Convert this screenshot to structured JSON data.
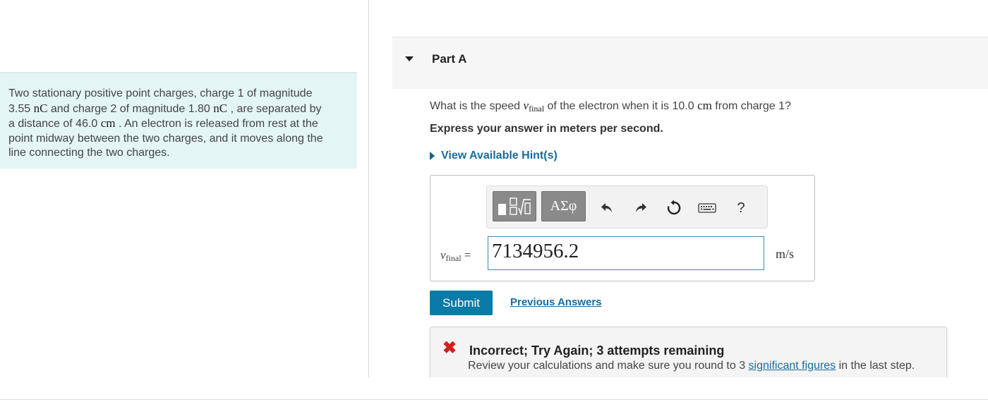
{
  "problem": {
    "t1": "Two stationary positive point charges, charge 1 of magnitude",
    "v1": "3.55",
    "u1": "nC",
    "t2": " and charge 2 of magnitude ",
    "v2": "1.80",
    "u2": "nC",
    "t3": " , are separated by",
    "t4": "a distance of ",
    "v3": "46.0",
    "u3": "cm",
    "t5": " . An electron is released from rest at the",
    "t6": "point midway between the two charges, and it moves along the",
    "t7": "line connecting the two charges."
  },
  "part": {
    "title": "Part A"
  },
  "question": {
    "pre": "What is the speed ",
    "var": "v",
    "var_sub": "final",
    "mid": " of the electron when it is 10.0 ",
    "unit": "cm",
    "post": " from charge 1?"
  },
  "instruction": "Express your answer in meters per second.",
  "hints_label": "View Available Hint(s)",
  "toolbar": {
    "greek_label": "ΑΣφ",
    "help_label": "?"
  },
  "answer": {
    "var": "v",
    "var_sub": "final",
    "equals": " =",
    "value": "7134956.2",
    "unit": "m/s"
  },
  "submit_label": "Submit",
  "previous_answers_label": "Previous Answers",
  "feedback": {
    "icon": "✖",
    "title": "Incorrect; Try Again; 3 attempts remaining",
    "text_pre": "Review your calculations and make sure you round to 3 ",
    "link": "significant figures",
    "text_post": " in the last step."
  },
  "colors": {
    "accent": "#0a7aa6",
    "link": "#1a6b9b",
    "problem_bg": "#e4f5f5",
    "error": "#d21f1f"
  }
}
